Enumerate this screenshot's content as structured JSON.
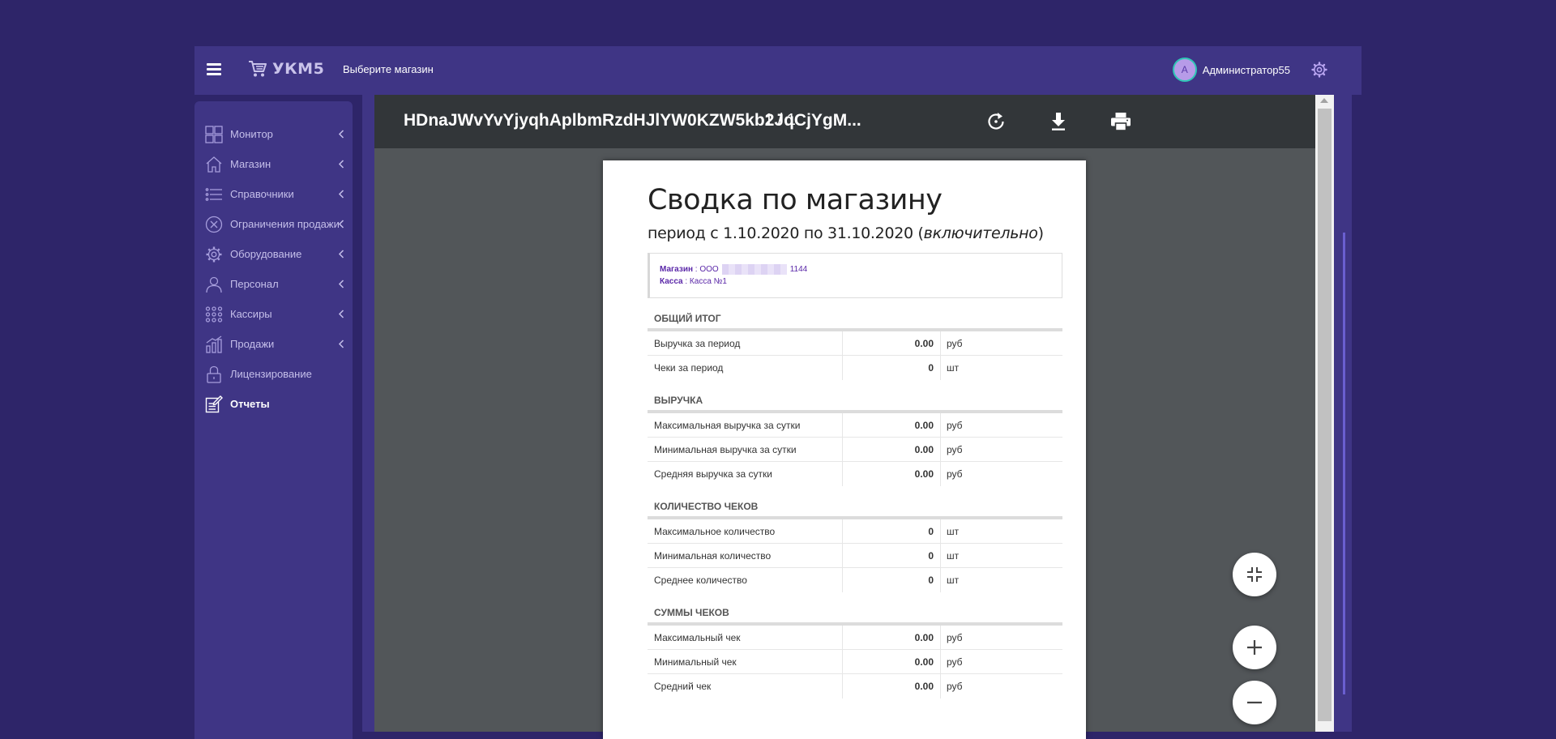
{
  "header": {
    "logo_text": "УКМ5",
    "store_select_label": "Выберите магазин",
    "user": {
      "avatar_letter": "A",
      "name": "Администратор55"
    }
  },
  "sidebar": {
    "items": [
      {
        "label": "Монитор",
        "icon": "monitor-grid-icon",
        "has_submenu": true
      },
      {
        "label": "Магазин",
        "icon": "house-icon",
        "has_submenu": true
      },
      {
        "label": "Справочники",
        "icon": "list-icon",
        "has_submenu": true
      },
      {
        "label": "Ограничения продажи",
        "icon": "restriction-icon",
        "has_submenu": true
      },
      {
        "label": "Оборудование",
        "icon": "gear-icon",
        "has_submenu": true
      },
      {
        "label": "Персонал",
        "icon": "person-icon",
        "has_submenu": true
      },
      {
        "label": "Кассиры",
        "icon": "dots-grid-icon",
        "has_submenu": true
      },
      {
        "label": "Продажи",
        "icon": "sales-chart-icon",
        "has_submenu": true
      },
      {
        "label": "Лицензирование",
        "icon": "lock-icon",
        "has_submenu": false
      },
      {
        "label": "Отчеты",
        "icon": "report-edit-icon",
        "has_submenu": false,
        "active": true
      }
    ]
  },
  "viewer": {
    "doc_title": "HDnaJWvYvYjyqhAplbmRzdHJlYW0KZW5kb2JqCjYgM...",
    "page_count": "1 / 1",
    "tools": [
      "rotate-icon",
      "download-icon",
      "print-icon"
    ]
  },
  "report": {
    "title": "Сводка по магазину",
    "period_prefix": "период с 1.10.2020 по 31.10.2020 (",
    "period_italic": "включительно",
    "period_suffix": ")",
    "store_label": "Магазин",
    "store_value_prefix": " : ООО",
    "store_value_suffix": "1144",
    "cash_label": "Касса",
    "cash_value": " : Касса №1",
    "sections": [
      {
        "title": "ОБЩИЙ ИТОГ",
        "rows": [
          {
            "label": "Выручка за период",
            "value": "0.00",
            "unit": "руб"
          },
          {
            "label": "Чеки за период",
            "value": "0",
            "unit": "шт"
          }
        ]
      },
      {
        "title": "ВЫРУЧКА",
        "rows": [
          {
            "label": "Максимальная выручка за сутки",
            "value": "0.00",
            "unit": "руб"
          },
          {
            "label": "Минимальная выручка за сутки",
            "value": "0.00",
            "unit": "руб"
          },
          {
            "label": "Средняя выручка за сутки",
            "value": "0.00",
            "unit": "руб"
          }
        ]
      },
      {
        "title": "КОЛИЧЕСТВО ЧЕКОВ",
        "rows": [
          {
            "label": "Максимальное количество",
            "value": "0",
            "unit": "шт"
          },
          {
            "label": "Минимальная количество",
            "value": "0",
            "unit": "шт"
          },
          {
            "label": "Среднее количество",
            "value": "0",
            "unit": "шт"
          }
        ]
      },
      {
        "title": "СУММЫ ЧЕКОВ",
        "rows": [
          {
            "label": "Максимальный чек",
            "value": "0.00",
            "unit": "руб"
          },
          {
            "label": "Минимальный чек",
            "value": "0.00",
            "unit": "руб"
          },
          {
            "label": "Средний чек",
            "value": "0.00",
            "unit": "руб"
          }
        ]
      }
    ]
  },
  "fabs": [
    "fit-page-icon",
    "zoom-in-icon",
    "zoom-out-icon"
  ],
  "colors": {
    "background": "#2e2569",
    "panel": "#3f3585",
    "viewer_bg": "#525659",
    "toolbar": "#323639",
    "accent": "#5a27a8"
  }
}
